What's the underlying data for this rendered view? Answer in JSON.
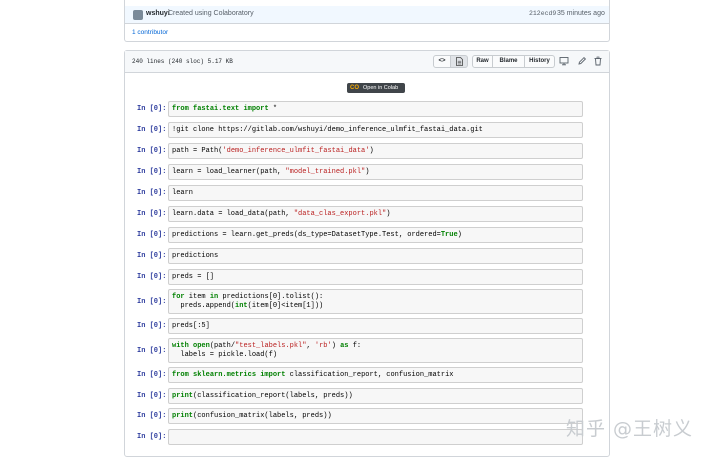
{
  "commit": {
    "author": "wshuyi",
    "message": "Created using Colaboratory",
    "sha": "212ecd9",
    "time": "35 minutes ago",
    "contributors": "1 contributor"
  },
  "file": {
    "info": "240 lines (240 sloc)   5.17 KB",
    "buttons": {
      "raw": "Raw",
      "blame": "Blame",
      "history": "History"
    },
    "icons": {
      "code_view": "<>",
      "file_view": "file-icon",
      "desktop": "desktop-icon",
      "edit": "pencil-icon",
      "delete": "trash-icon"
    }
  },
  "colab_badge": {
    "logo": "CO",
    "label": "Open in Colab"
  },
  "cells": [
    {
      "prompt": "In [0]:",
      "code": [
        [
          {
            "t": "from",
            "k": "kw"
          },
          {
            "t": " "
          },
          {
            "t": "fastai.text",
            "k": "kw"
          },
          {
            "t": " "
          },
          {
            "t": "import",
            "k": "kw"
          },
          {
            "t": " *"
          }
        ]
      ]
    },
    {
      "prompt": "In [0]:",
      "code": [
        [
          {
            "t": "!git clone https://gitlab.com/wshuyi/demo_inference_ulmfit_fastai_data.git"
          }
        ]
      ]
    },
    {
      "prompt": "In [0]:",
      "code": [
        [
          {
            "t": "path = Path("
          },
          {
            "t": "'demo_inference_ulmfit_fastai_data'",
            "k": "str"
          },
          {
            "t": ")"
          }
        ]
      ]
    },
    {
      "prompt": "In [0]:",
      "code": [
        [
          {
            "t": "learn = load_learner(path, "
          },
          {
            "t": "\"model_trained.pkl\"",
            "k": "str"
          },
          {
            "t": ")"
          }
        ]
      ]
    },
    {
      "prompt": "In [0]:",
      "code": [
        [
          {
            "t": "learn"
          }
        ]
      ]
    },
    {
      "prompt": "In [0]:",
      "code": [
        [
          {
            "t": "learn.data = load_data(path, "
          },
          {
            "t": "\"data_clas_export.pkl\"",
            "k": "str"
          },
          {
            "t": ")"
          }
        ]
      ]
    },
    {
      "prompt": "In [0]:",
      "code": [
        [
          {
            "t": "predictions = learn.get_preds(ds_type=DatasetType.Test, ordered="
          },
          {
            "t": "True",
            "k": "kw"
          },
          {
            "t": ")"
          }
        ]
      ]
    },
    {
      "prompt": "In [0]:",
      "code": [
        [
          {
            "t": "predictions"
          }
        ]
      ]
    },
    {
      "prompt": "In [0]:",
      "code": [
        [
          {
            "t": "preds = []"
          }
        ]
      ]
    },
    {
      "prompt": "In [0]:",
      "code": [
        [
          {
            "t": "for",
            "k": "kw"
          },
          {
            "t": " item "
          },
          {
            "t": "in",
            "k": "kw"
          },
          {
            "t": " predictions[0].tolist():"
          }
        ],
        [
          {
            "t": "  preds.append("
          },
          {
            "t": "int",
            "k": "kw"
          },
          {
            "t": "(item[0]<item[1]))"
          }
        ]
      ]
    },
    {
      "prompt": "In [0]:",
      "code": [
        [
          {
            "t": "preds[:5]"
          }
        ]
      ]
    },
    {
      "prompt": "In [0]:",
      "code": [
        [
          {
            "t": "with",
            "k": "kw"
          },
          {
            "t": " "
          },
          {
            "t": "open",
            "k": "kw"
          },
          {
            "t": "(path/"
          },
          {
            "t": "\"test_labels.pkl\"",
            "k": "str"
          },
          {
            "t": ", "
          },
          {
            "t": "'rb'",
            "k": "str"
          },
          {
            "t": ") "
          },
          {
            "t": "as",
            "k": "kw"
          },
          {
            "t": " f:"
          }
        ],
        [
          {
            "t": "  labels = pickle.load(f)"
          }
        ]
      ]
    },
    {
      "prompt": "In [0]:",
      "code": [
        [
          {
            "t": "from",
            "k": "kw"
          },
          {
            "t": " "
          },
          {
            "t": "sklearn.metrics",
            "k": "kw"
          },
          {
            "t": " "
          },
          {
            "t": "import",
            "k": "kw"
          },
          {
            "t": " classification_report, confusion_matrix"
          }
        ]
      ]
    },
    {
      "prompt": "In [0]:",
      "code": [
        [
          {
            "t": "print",
            "k": "kw"
          },
          {
            "t": "(classification_report(labels, preds))"
          }
        ]
      ]
    },
    {
      "prompt": "In [0]:",
      "code": [
        [
          {
            "t": "print",
            "k": "kw"
          },
          {
            "t": "(confusion_matrix(labels, preds))"
          }
        ]
      ]
    },
    {
      "prompt": "In [0]:",
      "code": [
        [
          {
            "t": ""
          }
        ]
      ]
    }
  ],
  "watermark": "知乎 @王树义"
}
